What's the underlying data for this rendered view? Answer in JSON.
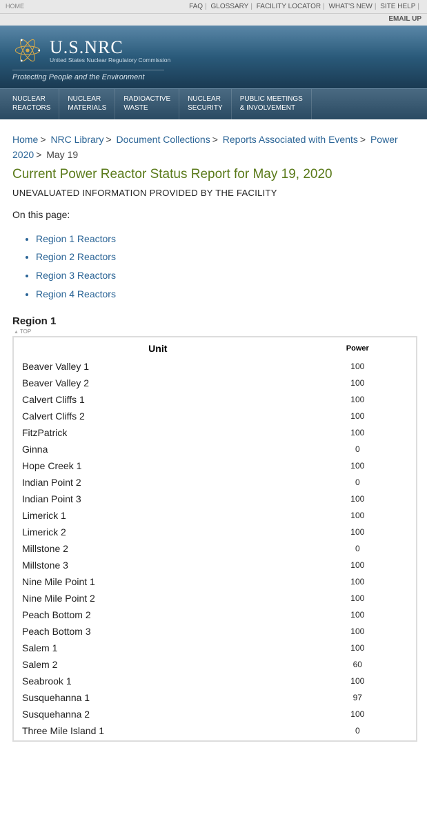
{
  "topnav": {
    "home": "HOME",
    "items": [
      "FAQ",
      "GLOSSARY",
      "FACILITY LOCATOR",
      "WHAT'S NEW",
      "SITE HELP"
    ],
    "email": "EMAIL UP"
  },
  "brand": {
    "name": "U.S.NRC",
    "subtitle": "United States Nuclear Regulatory Commission",
    "tagline": "Protecting People and the Environment"
  },
  "mainnav": [
    {
      "l1": "NUCLEAR",
      "l2": "REACTORS"
    },
    {
      "l1": "NUCLEAR",
      "l2": "MATERIALS"
    },
    {
      "l1": "RADIOACTIVE",
      "l2": "WASTE"
    },
    {
      "l1": "NUCLEAR",
      "l2": "SECURITY"
    },
    {
      "l1": "PUBLIC MEETINGS",
      "l2": "& INVOLVEMENT"
    }
  ],
  "breadcrumb": {
    "home": "Home",
    "lib": "NRC Library",
    "doc": "Document Collections",
    "rep": "Reports Associated with Events",
    "pow": "Power",
    "yr": "2020",
    "day": "May 19"
  },
  "page_title": "Current Power Reactor Status Report for May 19, 2020",
  "notice": "UNEVALUATED INFORMATION PROVIDED BY THE FACILITY",
  "onpage": "On this page:",
  "anchors": [
    "Region 1 Reactors",
    "Region 2 Reactors",
    "Region 3 Reactors",
    "Region 4 Reactors"
  ],
  "region_label": "Region 1",
  "top_label": "TOP",
  "table": {
    "unit_h": "Unit",
    "power_h": "Power",
    "rows": [
      {
        "unit": "Beaver Valley 1",
        "power": "100"
      },
      {
        "unit": "Beaver Valley 2",
        "power": "100"
      },
      {
        "unit": "Calvert Cliffs 1",
        "power": "100"
      },
      {
        "unit": "Calvert Cliffs 2",
        "power": "100"
      },
      {
        "unit": "FitzPatrick",
        "power": "100"
      },
      {
        "unit": "Ginna",
        "power": "0"
      },
      {
        "unit": "Hope Creek 1",
        "power": "100"
      },
      {
        "unit": "Indian Point 2",
        "power": "0"
      },
      {
        "unit": "Indian Point 3",
        "power": "100"
      },
      {
        "unit": "Limerick 1",
        "power": "100"
      },
      {
        "unit": "Limerick 2",
        "power": "100"
      },
      {
        "unit": "Millstone 2",
        "power": "0"
      },
      {
        "unit": "Millstone 3",
        "power": "100"
      },
      {
        "unit": "Nine Mile Point 1",
        "power": "100"
      },
      {
        "unit": "Nine Mile Point 2",
        "power": "100"
      },
      {
        "unit": "Peach Bottom 2",
        "power": "100"
      },
      {
        "unit": "Peach Bottom 3",
        "power": "100"
      },
      {
        "unit": "Salem 1",
        "power": "100"
      },
      {
        "unit": "Salem 2",
        "power": "60"
      },
      {
        "unit": "Seabrook 1",
        "power": "100"
      },
      {
        "unit": "Susquehanna 1",
        "power": "97"
      },
      {
        "unit": "Susquehanna 2",
        "power": "100"
      },
      {
        "unit": "Three Mile Island 1",
        "power": "0"
      }
    ]
  }
}
